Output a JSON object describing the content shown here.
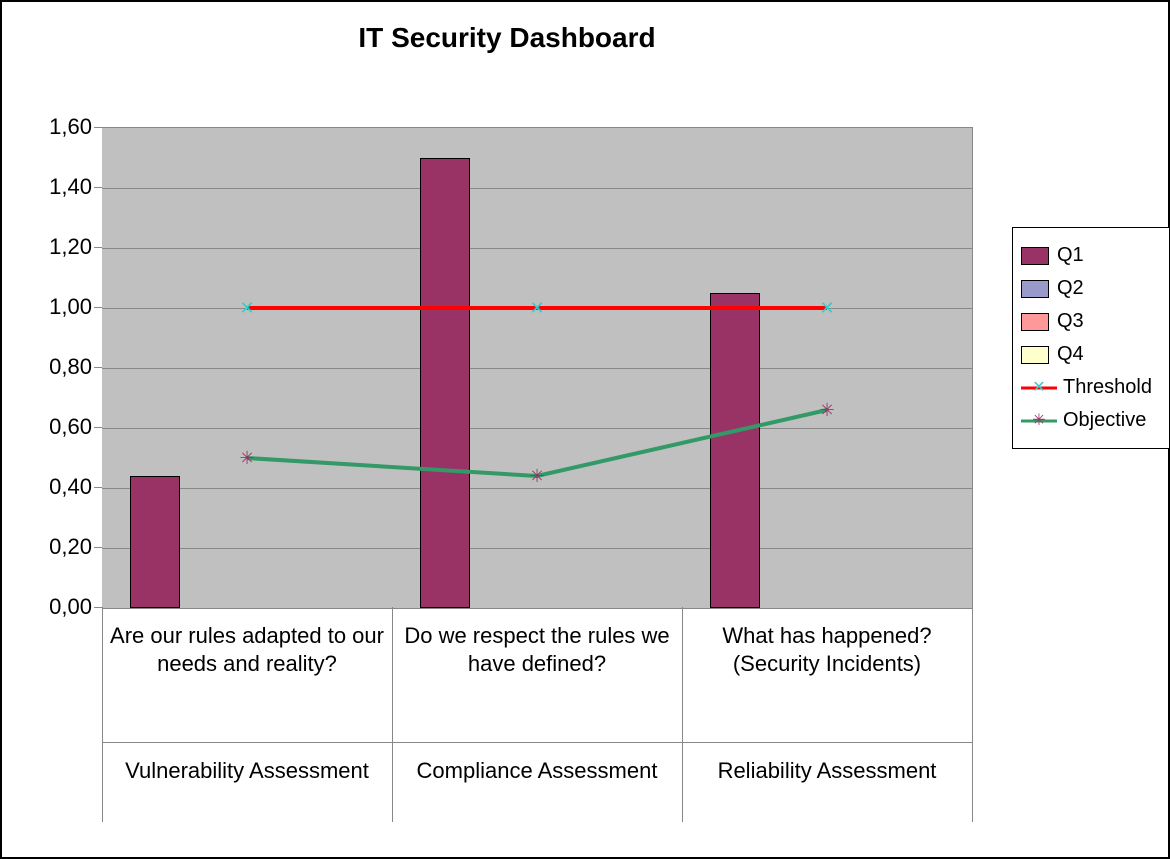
{
  "chart_data": {
    "type": "bar",
    "title": "IT Security Dashboard",
    "ylim": [
      0.0,
      1.6
    ],
    "ystep": 0.2,
    "yticks": [
      "0,00",
      "0,20",
      "0,40",
      "0,60",
      "0,80",
      "1,00",
      "1,20",
      "1,40",
      "1,60"
    ],
    "categories": [
      {
        "group": "Vulnerability Assessment",
        "label": "Are our rules adapted to our needs and reality?"
      },
      {
        "group": "Compliance Assessment",
        "label": "Do we respect the rules we have defined?"
      },
      {
        "group": "Reliability Assessment",
        "label": "What has happened? (Security Incidents)"
      }
    ],
    "series": [
      {
        "name": "Q1",
        "type": "bar",
        "color": "#993366",
        "values": [
          0.44,
          1.5,
          1.05
        ]
      },
      {
        "name": "Q2",
        "type": "bar",
        "color": "#9999cc",
        "values": [
          null,
          null,
          null
        ]
      },
      {
        "name": "Q3",
        "type": "bar",
        "color": "#ff9999",
        "values": [
          null,
          null,
          null
        ]
      },
      {
        "name": "Q4",
        "type": "bar",
        "color": "#ffffcc",
        "values": [
          null,
          null,
          null
        ]
      },
      {
        "name": "Threshold",
        "type": "line",
        "color": "#ff0000",
        "marker_color": "#33cccc",
        "marker": "x",
        "values": [
          1.0,
          1.0,
          1.0
        ]
      },
      {
        "name": "Objective",
        "type": "line",
        "color": "#339966",
        "marker_color": "#993366",
        "marker": "x",
        "values": [
          0.5,
          0.44,
          0.66
        ]
      }
    ],
    "legend_position": "right"
  }
}
